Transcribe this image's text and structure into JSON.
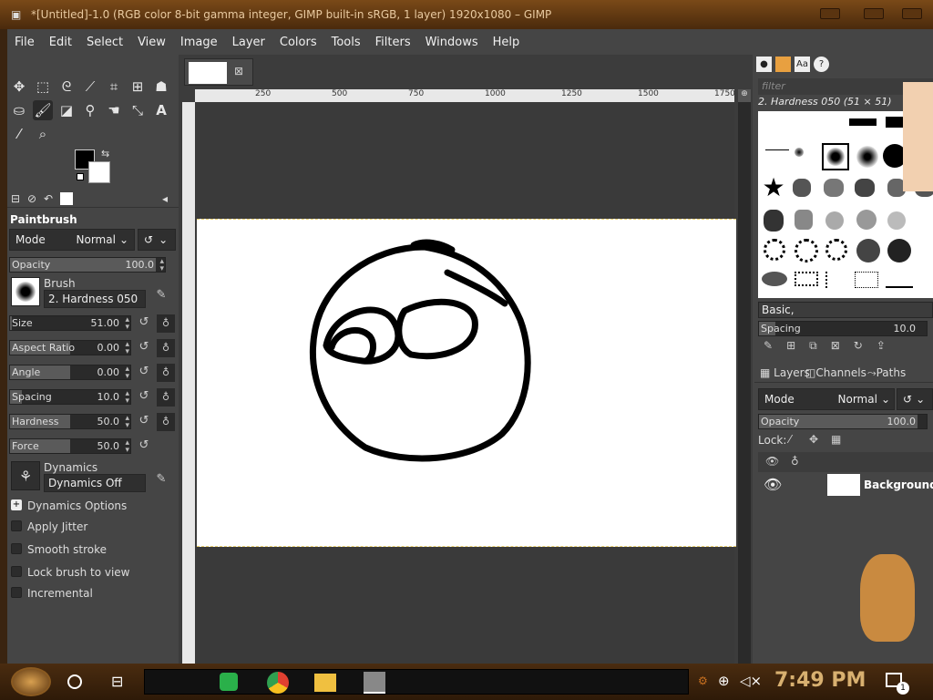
{
  "window": {
    "title": "*[Untitled]-1.0 (RGB color 8-bit gamma integer, GIMP built-in sRGB, 1 layer) 1920x1080 – GIMP"
  },
  "menu": [
    "File",
    "Edit",
    "Select",
    "View",
    "Image",
    "Layer",
    "Colors",
    "Tools",
    "Filters",
    "Windows",
    "Help"
  ],
  "toolbox": {
    "tools": [
      "move-icon",
      "rect-select-icon",
      "lasso-icon",
      "fuzzy-select-icon",
      "crop-icon",
      "transform-icon",
      "warp-icon",
      "bucket-fill-icon",
      "paintbrush-icon",
      "eraser-icon",
      "clone-icon",
      "smudge-icon",
      "path-icon",
      "text-icon",
      "color-picker-icon",
      "zoom-icon"
    ],
    "fg_color": "#000000",
    "bg_color": "#ffffff"
  },
  "tool_options": {
    "title": "Paintbrush",
    "mode_label": "Mode",
    "mode_value": "Normal",
    "opacity_label": "Opacity",
    "opacity_value": "100.0",
    "brush_label": "Brush",
    "brush_value": "2. Hardness 050",
    "sliders": [
      {
        "label": "Size",
        "value": "51.00",
        "fraction": 0.0
      },
      {
        "label": "Aspect Ratio",
        "value": "0.00",
        "fraction": 0.5
      },
      {
        "label": "Angle",
        "value": "0.00",
        "fraction": 0.5
      },
      {
        "label": "Spacing",
        "value": "10.0",
        "fraction": 0.1
      },
      {
        "label": "Hardness",
        "value": "50.0",
        "fraction": 0.5
      },
      {
        "label": "Force",
        "value": "50.0",
        "fraction": 0.5
      }
    ],
    "dynamics_label": "Dynamics",
    "dynamics_value": "Dynamics Off",
    "dynamics_options": "Dynamics Options",
    "checkboxes": [
      "Apply Jitter",
      "Smooth stroke",
      "Lock brush to view",
      "Incremental"
    ]
  },
  "canvas": {
    "ruler_ticks": [
      "250",
      "500",
      "750",
      "1000",
      "1250",
      "1500",
      "1750"
    ]
  },
  "brushes_panel": {
    "filter_placeholder": "filter",
    "selected_brush": "2. Hardness 050 (51 × 51)",
    "preset": "Basic,",
    "spacing_label": "Spacing",
    "spacing_value": "10.0"
  },
  "layers_panel": {
    "tabs": [
      "Layers",
      "Channels",
      "Paths"
    ],
    "mode_label": "Mode",
    "mode_value": "Normal",
    "opacity_label": "Opacity",
    "opacity_value": "100.0",
    "lock_label": "Lock:",
    "layer_name": "Background"
  },
  "taskbar": {
    "clock": "7:49 PM",
    "notification_count": "1"
  }
}
